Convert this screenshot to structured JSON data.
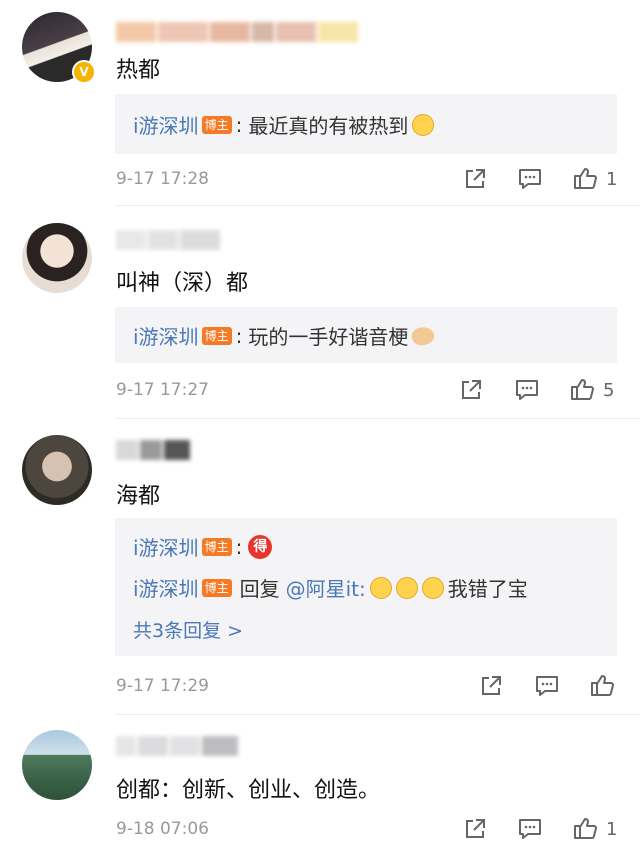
{
  "comments": [
    {
      "text": "热都",
      "replies": [
        {
          "name": "i游深圳",
          "badge": "博主",
          "colon": ":",
          "text": "最近真的有被热到"
        }
      ],
      "time": "9-17 17:28",
      "likes": "1",
      "avatar_color": "#3a3340",
      "icons": [
        "repost-icon",
        "comment-icon",
        "like-icon"
      ]
    },
    {
      "text": "叫神（深）都",
      "replies": [
        {
          "name": "i游深圳",
          "badge": "博主",
          "colon": ":",
          "text": "玩的一手好谐音梗"
        }
      ],
      "time": "9-17 17:27",
      "likes": "5",
      "avatar_color": "#d9c9bd"
    },
    {
      "text": "海都",
      "replies": [
        {
          "name": "i游深圳",
          "badge": "博主",
          "colon": ":",
          "emoji": "得"
        },
        {
          "name": "i游深圳",
          "badge": "博主",
          "reply_prefix": "回复",
          "mention": "@阿星it:",
          "text": "我错了宝"
        }
      ],
      "more_replies": "共3条回复 >",
      "time": "9-17 17:29",
      "likes": "",
      "avatar_color": "#6f6a5c"
    },
    {
      "text": "创都：创新、创业、创造。",
      "replies": [],
      "time": "9-18 07:06",
      "likes": "1",
      "avatar_color": "#5a8a9a"
    }
  ]
}
